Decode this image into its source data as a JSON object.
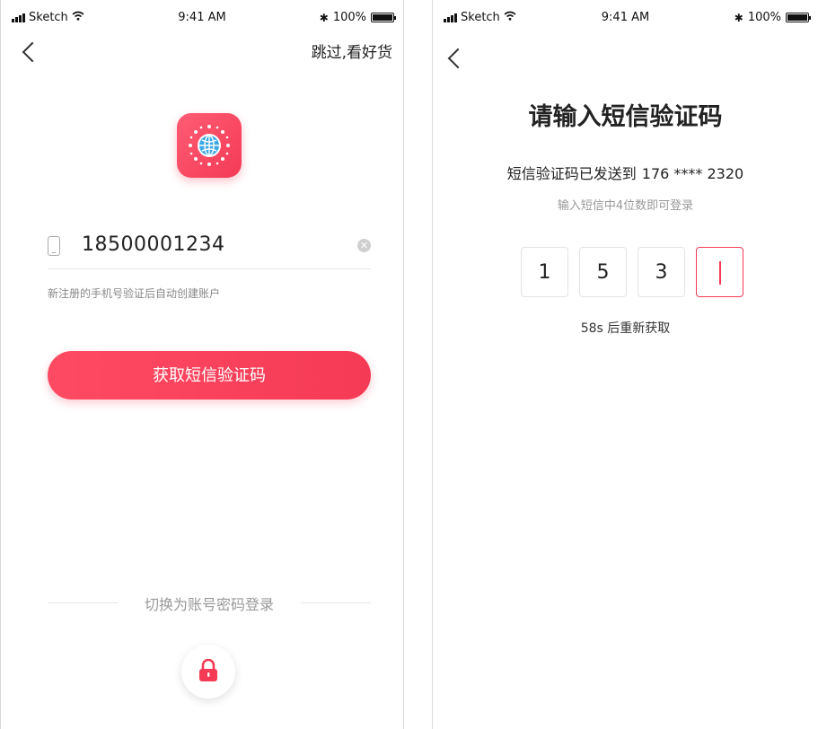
{
  "left_screen": {
    "status_bar": {
      "carrier": "Sketch",
      "time": "9:41 AM",
      "battery": "100%"
    },
    "skip_label": "跳过,看好货",
    "phone_input": {
      "value": "18500001234"
    },
    "hint": "新注册的手机号验证后自动创建账户",
    "primary_button": "获取短信验证码",
    "switch_label": "切换为账号密码登录",
    "icons": [
      "back-icon",
      "app-logo-icon",
      "phone-icon",
      "clear-icon",
      "lock-icon"
    ]
  },
  "right_screen": {
    "status_bar": {
      "carrier": "Sketch",
      "time": "9:41 AM",
      "battery": "100%"
    },
    "title": "请输入短信验证码",
    "sent_to_label": "短信验证码已发送到",
    "sent_to_phone": "176 **** 2320",
    "sub_hint": "输入短信中4位数即可登录",
    "code_digits": [
      "1",
      "5",
      "3",
      ""
    ],
    "resend_label": "58s 后重新获取"
  },
  "colors": {
    "accent": "#f53a55",
    "text": "#222222",
    "muted": "#999999"
  }
}
